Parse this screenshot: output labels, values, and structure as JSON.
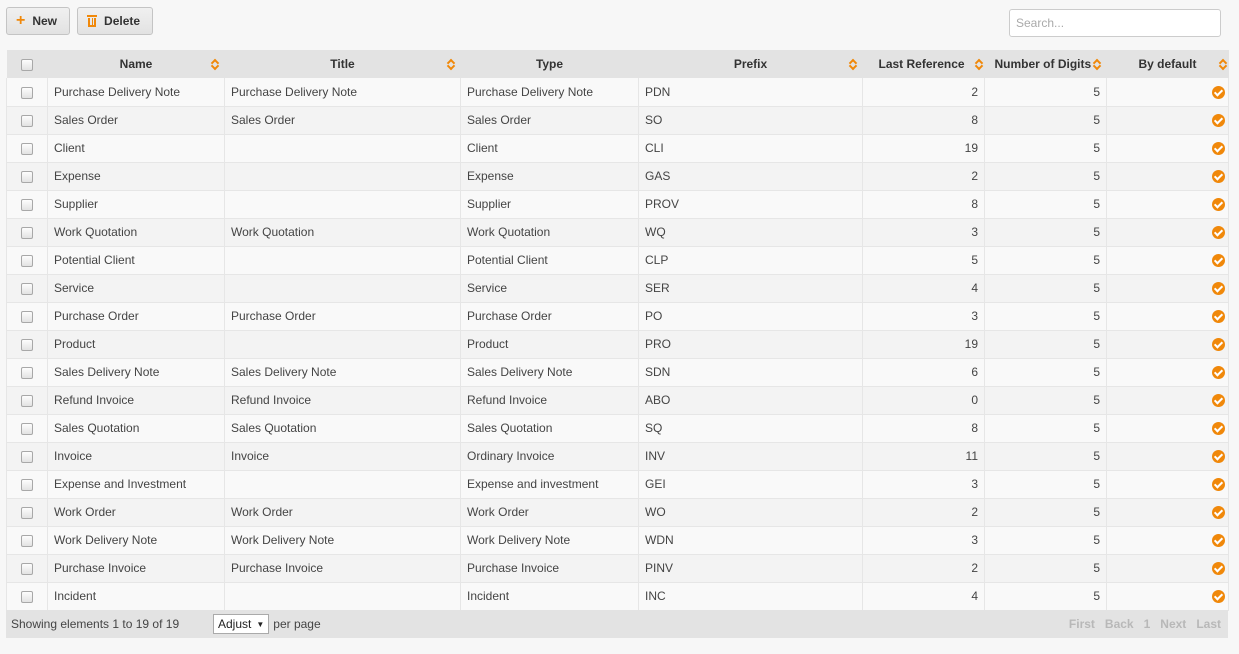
{
  "toolbar": {
    "new_label": "New",
    "delete_label": "Delete",
    "search_placeholder": "Search..."
  },
  "colors": {
    "accent": "#f0880a",
    "header_bg": "#e3e3e3"
  },
  "table": {
    "columns": [
      "Name",
      "Title",
      "Type",
      "Prefix",
      "Last Reference",
      "Number of Digits",
      "By default"
    ],
    "rows": [
      {
        "name": "Purchase Delivery Note",
        "title": "Purchase Delivery Note",
        "type": "Purchase Delivery Note",
        "prefix": "PDN",
        "last_ref": "2",
        "digits": "5",
        "default": true
      },
      {
        "name": "Sales Order",
        "title": "Sales Order",
        "type": "Sales Order",
        "prefix": "SO",
        "last_ref": "8",
        "digits": "5",
        "default": true
      },
      {
        "name": "Client",
        "title": "",
        "type": "Client",
        "prefix": "CLI",
        "last_ref": "19",
        "digits": "5",
        "default": true
      },
      {
        "name": "Expense",
        "title": "",
        "type": "Expense",
        "prefix": "GAS",
        "last_ref": "2",
        "digits": "5",
        "default": true
      },
      {
        "name": "Supplier",
        "title": "",
        "type": "Supplier",
        "prefix": "PROV",
        "last_ref": "8",
        "digits": "5",
        "default": true
      },
      {
        "name": "Work Quotation",
        "title": "Work Quotation",
        "type": "Work Quotation",
        "prefix": "WQ",
        "last_ref": "3",
        "digits": "5",
        "default": true
      },
      {
        "name": "Potential Client",
        "title": "",
        "type": "Potential Client",
        "prefix": "CLP",
        "last_ref": "5",
        "digits": "5",
        "default": true
      },
      {
        "name": "Service",
        "title": "",
        "type": "Service",
        "prefix": "SER",
        "last_ref": "4",
        "digits": "5",
        "default": true
      },
      {
        "name": "Purchase Order",
        "title": "Purchase Order",
        "type": "Purchase Order",
        "prefix": "PO",
        "last_ref": "3",
        "digits": "5",
        "default": true
      },
      {
        "name": "Product",
        "title": "",
        "type": "Product",
        "prefix": "PRO",
        "last_ref": "19",
        "digits": "5",
        "default": true
      },
      {
        "name": "Sales Delivery Note",
        "title": "Sales Delivery Note",
        "type": "Sales Delivery Note",
        "prefix": "SDN",
        "last_ref": "6",
        "digits": "5",
        "default": true
      },
      {
        "name": "Refund Invoice",
        "title": "Refund Invoice",
        "type": "Refund Invoice",
        "prefix": "ABO",
        "last_ref": "0",
        "digits": "5",
        "default": true
      },
      {
        "name": "Sales Quotation",
        "title": "Sales Quotation",
        "type": "Sales Quotation",
        "prefix": "SQ",
        "last_ref": "8",
        "digits": "5",
        "default": true
      },
      {
        "name": "Invoice",
        "title": "Invoice",
        "type": "Ordinary Invoice",
        "prefix": "INV",
        "last_ref": "11",
        "digits": "5",
        "default": true
      },
      {
        "name": "Expense and Investment",
        "title": "",
        "type": "Expense and investment",
        "prefix": "GEI",
        "last_ref": "3",
        "digits": "5",
        "default": true
      },
      {
        "name": "Work Order",
        "title": "Work Order",
        "type": "Work Order",
        "prefix": "WO",
        "last_ref": "2",
        "digits": "5",
        "default": true
      },
      {
        "name": "Work Delivery Note",
        "title": "Work Delivery Note",
        "type": "Work Delivery Note",
        "prefix": "WDN",
        "last_ref": "3",
        "digits": "5",
        "default": true
      },
      {
        "name": "Purchase Invoice",
        "title": "Purchase Invoice",
        "type": "Purchase Invoice",
        "prefix": "PINV",
        "last_ref": "2",
        "digits": "5",
        "default": true
      },
      {
        "name": "Incident",
        "title": "",
        "type": "Incident",
        "prefix": "INC",
        "last_ref": "4",
        "digits": "5",
        "default": true
      }
    ]
  },
  "footer": {
    "info": "Showing elements 1 to 19 of 19",
    "page_size": "Adjust",
    "per_page_label": "per page",
    "pager": {
      "first": "First",
      "back": "Back",
      "current": "1",
      "next": "Next",
      "last": "Last"
    }
  }
}
